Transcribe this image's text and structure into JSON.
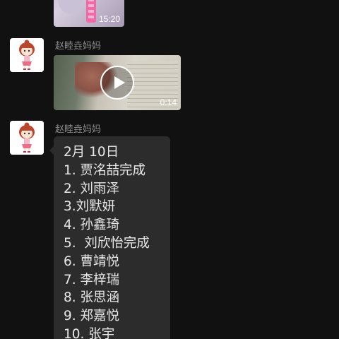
{
  "top_video": {
    "duration": "15:20"
  },
  "messages": [
    {
      "sender": "赵睦垚妈妈",
      "type": "video",
      "duration": "0:14"
    },
    {
      "sender": "赵睦垚妈妈",
      "type": "text",
      "lines": [
        "2月 10日",
        "1. 贾洺喆完成",
        "2. 刘雨泽",
        "3.刘默妍",
        "4. 孙鑫琦",
        "5.  刘欣怡完成",
        "6. 曹靖悦",
        "7. 李梓瑞",
        "8. 张思涵",
        "9. 郑嘉悦",
        "10. 张宇"
      ]
    }
  ],
  "icons": {
    "avatar": "cartoon-girl-avatar",
    "play": "play-icon"
  },
  "colors": {
    "background": "#111111",
    "bubble": "#2c2c2c",
    "sender_text": "#8c8c8c",
    "message_text": "#e8e8e8"
  }
}
